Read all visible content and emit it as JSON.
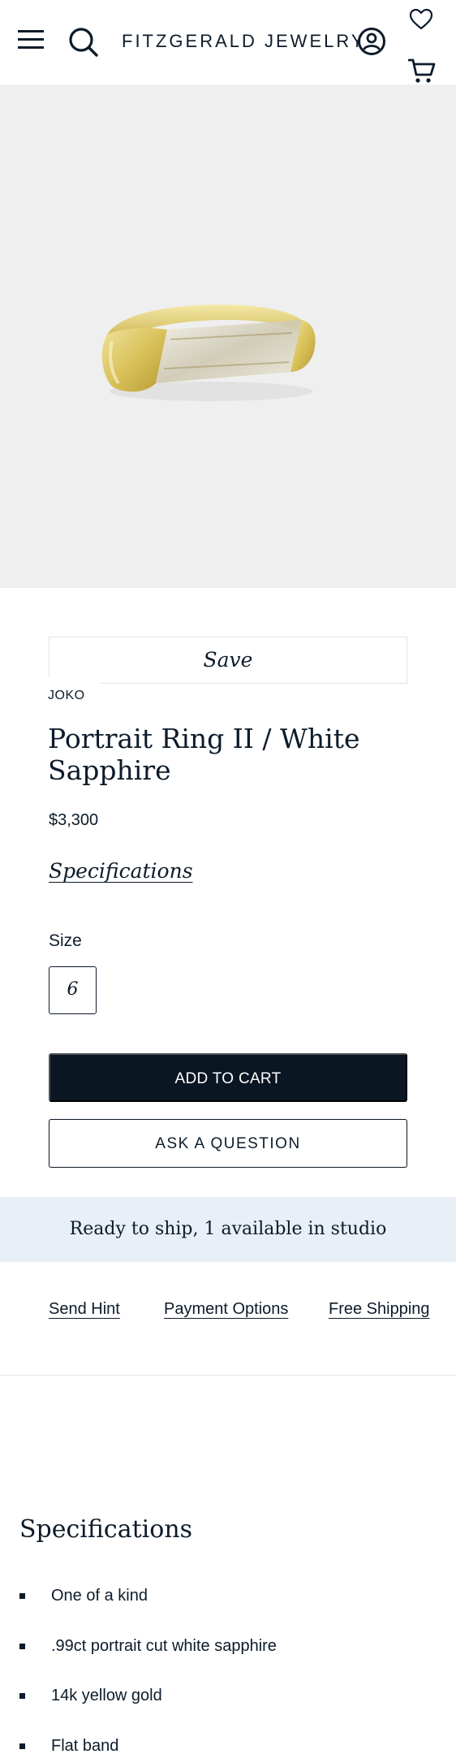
{
  "header": {
    "brand": "FITZGERALD JEWELRY",
    "icons": [
      "menu-icon",
      "search-icon",
      "account-icon",
      "heart-icon",
      "cart-icon"
    ]
  },
  "product": {
    "save_label": "Save",
    "vendor": "JOKO",
    "title": "Portrait Ring II / White Sapphire",
    "price": "$3,300",
    "specifications_link": "Specifications",
    "size_label": "Size",
    "size_selected": "6",
    "add_to_cart_label": "ADD TO CART",
    "ask_question_label": "ASK A QUESTION"
  },
  "availability": {
    "text": "Ready to ship, 1 available in studio"
  },
  "links": {
    "send_hint": "Send Hint",
    "payment_options": "Payment Options",
    "free_shipping": "Free Shipping"
  },
  "specifications": {
    "heading": "Specifications",
    "items": [
      "One of a kind",
      ".99ct portrait cut white sapphire",
      "14k yellow gold",
      "Flat band"
    ]
  },
  "colors": {
    "primary": "#0b1623",
    "hero_background": "#efefef",
    "availability_background": "#e9eff6",
    "gold": "#d9c25a"
  }
}
